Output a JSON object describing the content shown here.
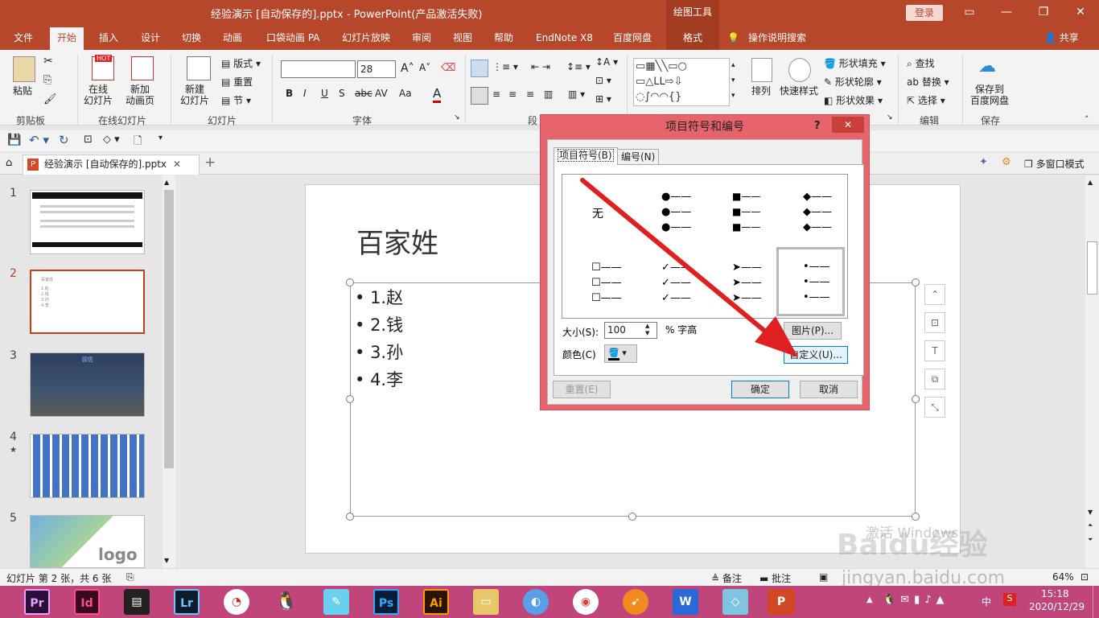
{
  "window": {
    "title": "经验演示 [自动保存的].pptx  -  PowerPoint(产品激活失败)",
    "context_tab": "绘图工具",
    "login": "登录",
    "share": "共享"
  },
  "tabs": [
    "文件",
    "开始",
    "插入",
    "设计",
    "切换",
    "动画",
    "口袋动画 PA",
    "幻灯片放映",
    "审阅",
    "视图",
    "帮助",
    "EndNote X8",
    "百度网盘",
    "格式"
  ],
  "tell_me": "操作说明搜索",
  "ribbon": {
    "clipboard": {
      "paste": "粘贴",
      "group": "剪贴板"
    },
    "online": {
      "online_slides": "在线\n幻灯片",
      "new_page": "新加\n动画页",
      "hot": "HOT",
      "group": "在线幻灯片"
    },
    "slides": {
      "new_slide": "新建\n幻灯片",
      "layout": "版式",
      "reset": "重置",
      "section": "节",
      "group": "幻灯片"
    },
    "font": {
      "font_name": "",
      "font_size": "28",
      "group": "字体",
      "b": "B",
      "i": "I",
      "u": "U",
      "s": "S",
      "av": "AV",
      "aa": "Aa",
      "a": "A"
    },
    "paragraph": {
      "group": "段"
    },
    "drawing": {
      "arrange": "排列",
      "quick_styles": "快速样式",
      "fill": "形状填充",
      "outline": "形状轮廓",
      "effects": "形状效果"
    },
    "editing": {
      "find": "查找",
      "replace": "替换",
      "select": "选择",
      "group": "编辑"
    },
    "save": {
      "save_to": "保存到\n百度网盘",
      "group": "保存"
    }
  },
  "doc_tab": "经验演示 [自动保存的].pptx",
  "multiwin": "多窗口模式",
  "thumbnails": [
    {
      "num": "1"
    },
    {
      "num": "2"
    },
    {
      "num": "3"
    },
    {
      "num": "4",
      "star": "★"
    },
    {
      "num": "5"
    }
  ],
  "slide": {
    "title": "百家姓",
    "items": [
      "1.赵",
      "2.钱",
      "3.孙",
      "4.李"
    ],
    "thumb3_title": "感悟",
    "thumb5_logo": "logo"
  },
  "watermark": {
    "line1": "激活 Windows",
    "baidu": "Baidu经验",
    "url": "jingyan.baidu.com"
  },
  "status": {
    "slide_info": "幻灯片 第 2 张，共 6 张",
    "notes": "备注",
    "comments": "批注",
    "zoom": "64%"
  },
  "taskbar": {
    "apps": [
      "Pr",
      "Id",
      "",
      "Lr",
      "",
      "",
      "",
      "Ps",
      "Ai",
      "",
      "",
      "",
      "",
      "",
      "",
      ""
    ],
    "time": "15:18",
    "date": "2020/12/29",
    "ime": "中"
  },
  "dialog": {
    "title": "项目符号和编号",
    "help": "?",
    "close": "✕",
    "tab_bullets": "项目符号(B)",
    "tab_numbers": "编号(N)",
    "none": "无",
    "size_label": "大小(S):",
    "size_value": "100",
    "size_unit": "% 字高",
    "color_label": "颜色(C)",
    "picture": "图片(P)...",
    "customize": "自定义(U)...",
    "reset": "重置(E)",
    "ok": "确定",
    "cancel": "取消"
  }
}
